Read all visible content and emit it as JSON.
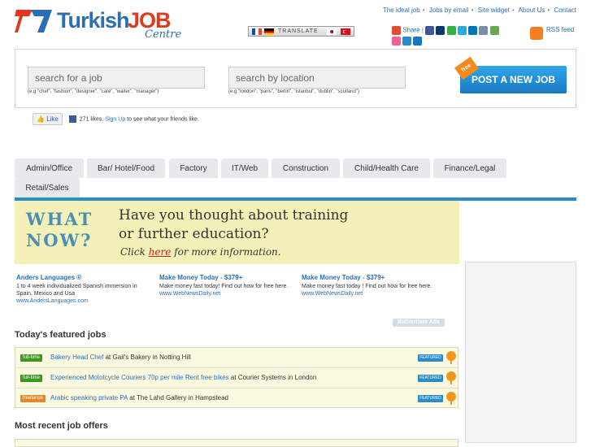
{
  "header": {
    "logo_word1": "Turkish",
    "logo_word2": "JOB",
    "logo_sub": "Centre",
    "nav": [
      "The ideal job",
      "Jobs by email",
      "Site widget",
      "About Us",
      "Contact"
    ],
    "translate_label": "TRANSLATE",
    "share_label": "Share",
    "rss_label": "RSS feed"
  },
  "search": {
    "job_placeholder": "search for a job",
    "job_hint": "(e.g \"chef\", \"fashion\", \"designer\", \"care\", \"waiter\", \"manager\")",
    "location_placeholder": "search by location",
    "location_hint": "(e.g \"london\", \"paris\", \"berlin\", \"istanbul\", \"dublin\", \"scotland\")",
    "post_button": "POST A NEW JOB",
    "post_badge": "free"
  },
  "like": {
    "button": "Like",
    "count_text": "271 likes.",
    "signup": "Sign Up",
    "rest": "to see what your friends like."
  },
  "tabs": [
    "Admin/Office",
    "Bar/ Hotel/Food",
    "Factory",
    "IT/Web",
    "Construction",
    "Child/Health Care",
    "Finance/Legal",
    "Retail/Sales"
  ],
  "banner": {
    "what": "WHAT",
    "now": "NOW?",
    "line1": "Have you thought about training",
    "line2": "or further education?",
    "click": "Click",
    "here": "here",
    "more": "for more information."
  },
  "text_ads": [
    {
      "title": "Anders Languages ®",
      "body": "1 to 4 week individualized Spanish immersion in Spain, Mexico and Usa",
      "url": "www.AndersLanguages.com"
    },
    {
      "title": "Make Money Today - $379+",
      "body": "Make money fast today! Find out how for free here.",
      "url": "www.WebNewsDaily.net"
    },
    {
      "title": "Make Money Today - $379+",
      "body": "Make money fast today ! Find out how for free here.",
      "url": "www.WebNewsDaily.net"
    }
  ],
  "ads_label": "BidVertiser Ads",
  "featured_title": "Today's featured jobs",
  "featured_jobs": [
    {
      "type": "full-time",
      "type_color": "#3a9a1e",
      "title": "Bakery Head Chef",
      "at": "at",
      "company": "Gail's Bakery",
      "in": "in",
      "location": "Notting Hill",
      "badge": "FEATURED"
    },
    {
      "type": "full-time",
      "type_color": "#3a9a1e",
      "title": "Experienced Mototcycle Couriers 70p per mile Rent free bikes",
      "at": "at",
      "company": "Courier Systems",
      "in": "in",
      "location": "London",
      "badge": "FEATURED"
    },
    {
      "type": "freelance",
      "type_color": "#e8862a",
      "title": "Arabic speaking private PA",
      "at": "at",
      "company": "The Lahd Gallery",
      "in": "in",
      "location": "Hampstead",
      "badge": "FEATURED"
    }
  ],
  "recent_title": "Most recent job offers"
}
